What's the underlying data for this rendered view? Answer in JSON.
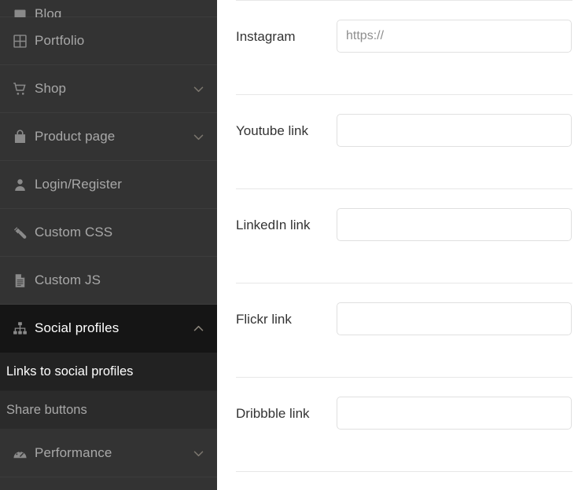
{
  "sidebar": {
    "items": [
      {
        "label": "Blog",
        "icon": "blog-icon",
        "expandable": false,
        "clipped": true,
        "active": false
      },
      {
        "label": "Portfolio",
        "icon": "grid-icon",
        "expandable": false,
        "clipped": false,
        "active": false
      },
      {
        "label": "Shop",
        "icon": "cart-icon",
        "expandable": true,
        "clipped": false,
        "active": false,
        "chevron": "chevron-down"
      },
      {
        "label": "Product page",
        "icon": "bag-icon",
        "expandable": true,
        "clipped": false,
        "active": false,
        "chevron": "chevron-down"
      },
      {
        "label": "Login/Register",
        "icon": "user-icon",
        "expandable": false,
        "clipped": false,
        "active": false
      },
      {
        "label": "Custom CSS",
        "icon": "paintbrush-icon",
        "expandable": false,
        "clipped": false,
        "active": false
      },
      {
        "label": "Custom JS",
        "icon": "document-icon",
        "expandable": false,
        "clipped": false,
        "active": false
      },
      {
        "label": "Social profiles",
        "icon": "sitemap-icon",
        "expandable": true,
        "clipped": false,
        "active": true,
        "chevron": "chevron-up"
      }
    ],
    "sub_items": [
      {
        "label": "Links to social profiles",
        "active": true
      },
      {
        "label": "Share buttons",
        "active": false
      }
    ],
    "trailing_items": [
      {
        "label": "Performance",
        "icon": "gauge-icon",
        "expandable": true,
        "chevron": "chevron-down",
        "active": false
      }
    ],
    "colors": {
      "background": "#333333",
      "active_background": "#151515",
      "sub_background": "#2b2b2b",
      "sub_active_background": "#222222",
      "label": "#a8a8a8",
      "active_label": "#ffffff"
    }
  },
  "content": {
    "fields": [
      {
        "label": "Instagram",
        "value": "",
        "placeholder": "https://"
      },
      {
        "label": "Youtube link",
        "value": "",
        "placeholder": ""
      },
      {
        "label": "LinkedIn link",
        "value": "",
        "placeholder": ""
      },
      {
        "label": "Flickr link",
        "value": "",
        "placeholder": ""
      },
      {
        "label": "Dribbble link",
        "value": "",
        "placeholder": ""
      }
    ],
    "colors": {
      "background": "#ffffff",
      "divider": "#e7e7e7",
      "input_border": "#e0e0e0",
      "label_text": "#333333",
      "placeholder_text": "#8e8e8e"
    }
  }
}
